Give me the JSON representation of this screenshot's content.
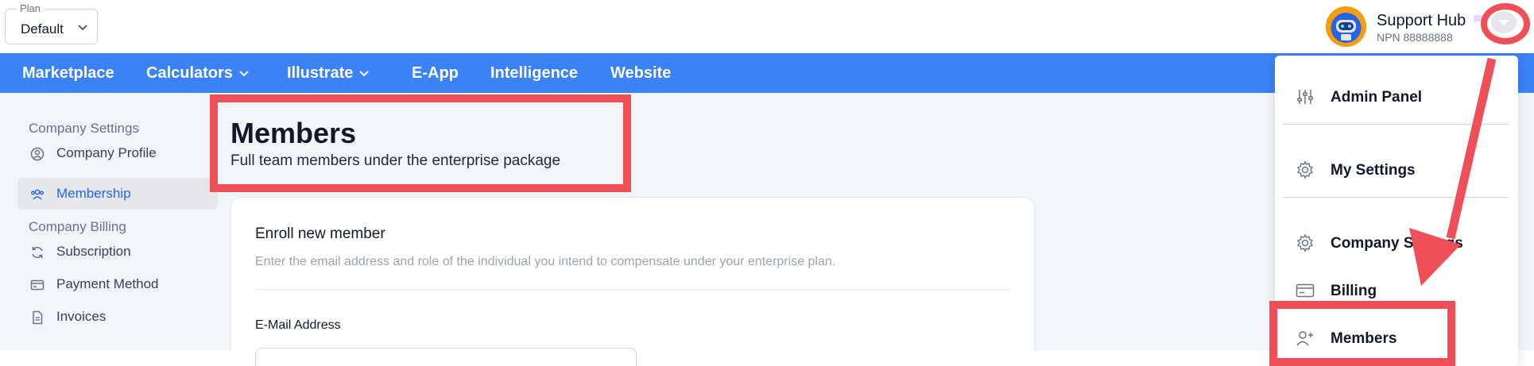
{
  "plan": {
    "label": "Plan",
    "value": "Default"
  },
  "user": {
    "name": "Support Hub",
    "npn": "NPN 88888888"
  },
  "nav": {
    "items": [
      {
        "label": "Marketplace",
        "dropdown": false
      },
      {
        "label": "Calculators",
        "dropdown": true
      },
      {
        "label": "Illustrate",
        "dropdown": true
      },
      {
        "label": "E-App",
        "dropdown": false
      },
      {
        "label": "Intelligence",
        "dropdown": false
      },
      {
        "label": "Website",
        "dropdown": false
      }
    ]
  },
  "sidebar": {
    "section_company_settings": "Company Settings",
    "section_company_billing": "Company Billing",
    "items": [
      {
        "label": "Company Profile",
        "icon": "user-circle-icon",
        "active": false
      },
      {
        "label": "Membership",
        "icon": "users-icon",
        "active": true
      },
      {
        "label": "Subscription",
        "icon": "refresh-icon",
        "active": false
      },
      {
        "label": "Payment Method",
        "icon": "credit-card-icon",
        "active": false
      },
      {
        "label": "Invoices",
        "icon": "document-icon",
        "active": false
      }
    ]
  },
  "page": {
    "title": "Members",
    "subtitle": "Full team members under the enterprise package"
  },
  "card": {
    "title": "Enroll new member",
    "description": "Enter the email address and role of the individual you intend to compensate under your enterprise plan.",
    "email_label": "E-Mail Address"
  },
  "menu": {
    "items": [
      {
        "label": "Admin Panel",
        "icon": "sliders-icon"
      },
      {
        "label": "My Settings",
        "icon": "gear-icon"
      },
      {
        "label": "Company Settings",
        "icon": "gear-icon"
      },
      {
        "label": "Billing",
        "icon": "credit-card-icon"
      },
      {
        "label": "Members",
        "icon": "user-plus-icon"
      }
    ]
  },
  "colors": {
    "nav_bg": "#3b82f6",
    "annotation": "#ef4f56",
    "active_text": "#2563eb",
    "content_bg": "#f1f5f9"
  }
}
